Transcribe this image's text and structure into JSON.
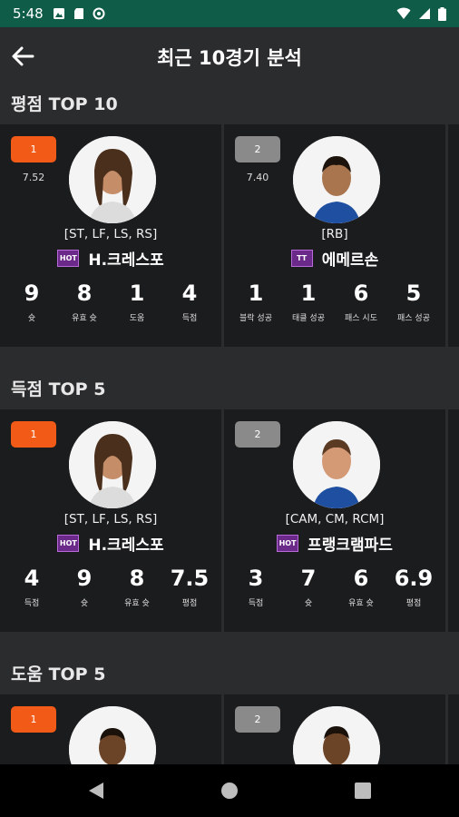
{
  "status": {
    "time": "5:48"
  },
  "header": {
    "title": "최근 10경기 분석"
  },
  "sections": [
    {
      "title": "평점 TOP 10",
      "cards": [
        {
          "rank": "1",
          "rating": "7.52",
          "position": "[ST, LF, LS, RS]",
          "badge": "HOT",
          "name": "H.크레스포",
          "stats": [
            {
              "value": "9",
              "label": "슛"
            },
            {
              "value": "8",
              "label": "유효 슛"
            },
            {
              "value": "1",
              "label": "도움"
            },
            {
              "value": "4",
              "label": "득점"
            }
          ]
        },
        {
          "rank": "2",
          "rating": "7.40",
          "position": "[RB]",
          "badge": "TT",
          "name": "에메르손",
          "stats": [
            {
              "value": "1",
              "label": "블락 성공"
            },
            {
              "value": "1",
              "label": "태클 성공"
            },
            {
              "value": "6",
              "label": "패스 시도"
            },
            {
              "value": "5",
              "label": "패스 성공"
            }
          ]
        }
      ]
    },
    {
      "title": "득점 TOP 5",
      "cards": [
        {
          "rank": "1",
          "position": "[ST, LF, LS, RS]",
          "badge": "HOT",
          "name": "H.크레스포",
          "stats": [
            {
              "value": "4",
              "label": "득점"
            },
            {
              "value": "9",
              "label": "슛"
            },
            {
              "value": "8",
              "label": "유효 슛"
            },
            {
              "value": "7.5",
              "label": "평점"
            }
          ]
        },
        {
          "rank": "2",
          "position": "[CAM, CM, RCM]",
          "badge": "HOT",
          "name": "프랭크램파드",
          "stats": [
            {
              "value": "3",
              "label": "득점"
            },
            {
              "value": "7",
              "label": "슛"
            },
            {
              "value": "6",
              "label": "유효 슛"
            },
            {
              "value": "6.9",
              "label": "평점"
            }
          ]
        }
      ]
    },
    {
      "title": "도움 TOP 5",
      "cards": [
        {
          "rank": "1"
        },
        {
          "rank": "2"
        }
      ]
    }
  ],
  "colors": {
    "status_bar": "#0f5c48",
    "rank1": "#f25a17",
    "rank2": "#8a8a8a",
    "badge_hot": "#6b2a8a"
  }
}
